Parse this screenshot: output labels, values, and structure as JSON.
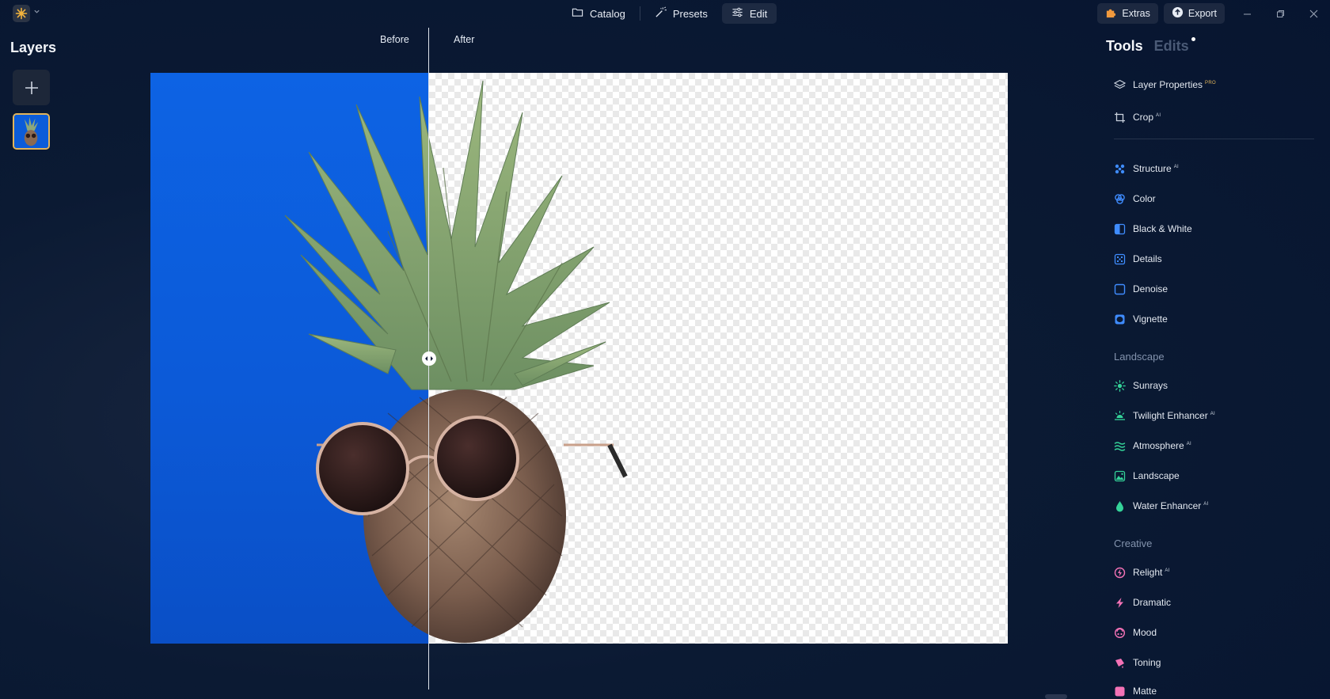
{
  "topbar": {
    "nav": [
      {
        "label": "Catalog",
        "icon": "folder-icon"
      },
      {
        "label": "Presets",
        "icon": "magic-wand-icon"
      },
      {
        "label": "Edit",
        "icon": "sliders-icon",
        "active": true
      }
    ],
    "extras_label": "Extras",
    "export_label": "Export"
  },
  "layers": {
    "title": "Layers"
  },
  "canvas": {
    "before_label": "Before",
    "after_label": "After"
  },
  "tools_panel": {
    "tab_tools": "Tools",
    "tab_edits": "Edits",
    "top_tools": [
      {
        "label": "Layer Properties",
        "badge": "PRO",
        "icon": "layers-icon"
      },
      {
        "label": "Crop",
        "badge": "AI",
        "icon": "crop-icon"
      }
    ],
    "essential_tools": [
      {
        "label": "Structure",
        "badge": "AI",
        "icon": "structure-icon"
      },
      {
        "label": "Color",
        "badge": "",
        "icon": "color-icon"
      },
      {
        "label": "Black & White",
        "badge": "",
        "icon": "black-white-icon"
      },
      {
        "label": "Details",
        "badge": "",
        "icon": "details-icon"
      },
      {
        "label": "Denoise",
        "badge": "",
        "icon": "denoise-icon"
      },
      {
        "label": "Vignette",
        "badge": "",
        "icon": "vignette-icon"
      }
    ],
    "landscape_section": "Landscape",
    "landscape_tools": [
      {
        "label": "Sunrays",
        "badge": "",
        "icon": "sun-icon"
      },
      {
        "label": "Twilight Enhancer",
        "badge": "AI",
        "icon": "twilight-icon"
      },
      {
        "label": "Atmosphere",
        "badge": "AI",
        "icon": "atmosphere-icon"
      },
      {
        "label": "Landscape",
        "badge": "",
        "icon": "landscape-icon"
      },
      {
        "label": "Water Enhancer",
        "badge": "AI",
        "icon": "water-drop-icon"
      }
    ],
    "creative_section": "Creative",
    "creative_tools": [
      {
        "label": "Relight",
        "badge": "AI",
        "icon": "relight-icon"
      },
      {
        "label": "Dramatic",
        "badge": "",
        "icon": "lightning-icon"
      },
      {
        "label": "Mood",
        "badge": "",
        "icon": "mood-icon"
      },
      {
        "label": "Toning",
        "badge": "",
        "icon": "toning-icon"
      },
      {
        "label": "Matte",
        "badge": "",
        "icon": "matte-icon"
      }
    ]
  },
  "colors": {
    "accent_gold": "#e2b45a",
    "tool_blue": "#3f8cff",
    "tool_green": "#34d399",
    "tool_pink": "#f472b6"
  }
}
